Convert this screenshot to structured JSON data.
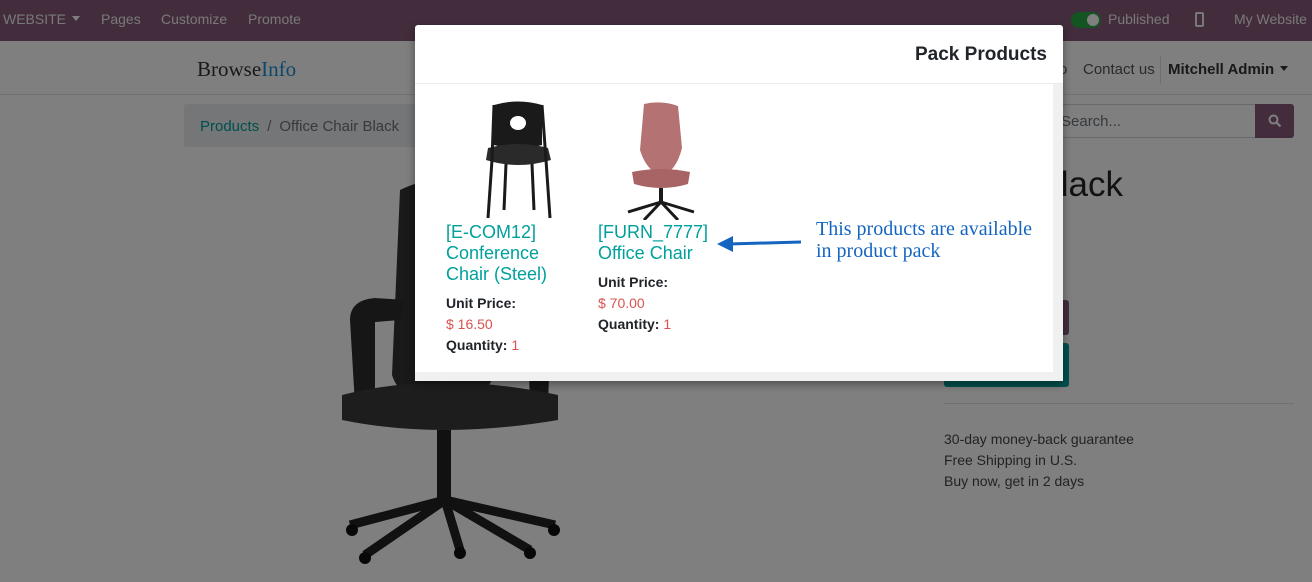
{
  "admin_bar": {
    "website_menu": "WEBSITE",
    "pages": "Pages",
    "customize": "Customize",
    "promote": "Promote",
    "published": "Published",
    "my_website": "My Website",
    "bar_color": "#875A7B"
  },
  "site_header": {
    "logo_part1": "Browse",
    "logo_part2": "Info",
    "nav_partial": "o",
    "contact": "Contact us",
    "user": "Mitchell Admin"
  },
  "breadcrumb": {
    "products": "Products",
    "separator": "/",
    "current": "Office Chair Black"
  },
  "search": {
    "placeholder": "Search..."
  },
  "product": {
    "title_visible": "Chair Black"
  },
  "benefits": [
    "30-day money-back guarantee",
    "Free Shipping in U.S.",
    "Buy now, get in 2 days"
  ],
  "modal": {
    "title": "Pack Products",
    "unit_price_label": "Unit Price:",
    "quantity_label": "Quantity:",
    "items": [
      {
        "name": "[E-COM12] Conference Chair (Steel)",
        "price": "$ 16.50",
        "quantity": "1",
        "image": "black-stacking-chair"
      },
      {
        "name": "[FURN_7777] Office Chair",
        "price": "$ 70.00",
        "quantity": "1",
        "image": "pink-swivel-chair"
      }
    ],
    "annotation_line1": "This products are available",
    "annotation_line2": "in product pack"
  },
  "colors": {
    "accent_teal": "#00A09D",
    "accent_purple": "#875A7B",
    "price_red": "#d9534f",
    "annotation_blue": "#1565c0"
  }
}
